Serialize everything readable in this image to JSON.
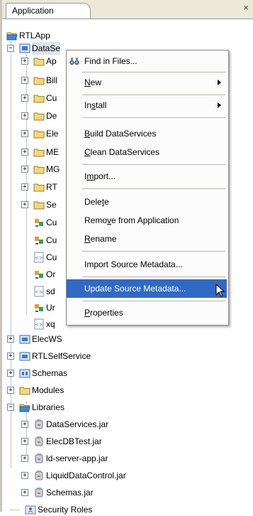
{
  "tab": {
    "title": "Application",
    "close": "×"
  },
  "tree": {
    "root": "RTLApp",
    "data_services": "DataSe",
    "children_partial": [
      "Ap",
      "Bill",
      "Cu",
      "De",
      "Ele",
      "ME",
      "MG",
      "RT",
      "Se",
      "Cu",
      "Cu",
      "Cu",
      "Or",
      "sd",
      "Ur",
      "xq"
    ],
    "siblings": [
      "ElecWS",
      "RTLSelfService",
      "Schemas",
      "Modules",
      "Libraries"
    ],
    "libraries": [
      "DataServices.jar",
      "ElecDBTest.jar",
      "ld-server-app.jar",
      "LiquidDataControl.jar",
      "Schemas.jar"
    ],
    "security_roles": "Security Roles"
  },
  "context_menu": {
    "find_in_files": {
      "pre": "Find in Files...",
      "ul": "",
      "post": ""
    },
    "new": {
      "pre": "",
      "ul": "N",
      "post": "ew"
    },
    "install": {
      "pre": "In",
      "ul": "s",
      "post": "tall"
    },
    "build": {
      "pre": "",
      "ul": "B",
      "post": "uild DataServices"
    },
    "clean": {
      "pre": "",
      "ul": "C",
      "post": "lean DataServices"
    },
    "import": {
      "pre": "I",
      "ul": "m",
      "post": "port..."
    },
    "delete": {
      "pre": "Dele",
      "ul": "t",
      "post": "e"
    },
    "remove": {
      "pre": "Remo",
      "ul": "v",
      "post": "e from Application"
    },
    "rename": {
      "pre": "",
      "ul": "R",
      "post": "ename"
    },
    "import_metadata": {
      "pre": "Import Source Metadata...",
      "ul": "",
      "post": ""
    },
    "update_metadata": {
      "pre": "Update Source Metadata...",
      "ul": "",
      "post": ""
    },
    "properties": {
      "pre": "",
      "ul": "P",
      "post": "roperties"
    }
  },
  "colors": {
    "highlight": "#3169c6",
    "folder": "#f5d67a",
    "project": "#3a7bd5",
    "jar": "#9aa8b8"
  }
}
